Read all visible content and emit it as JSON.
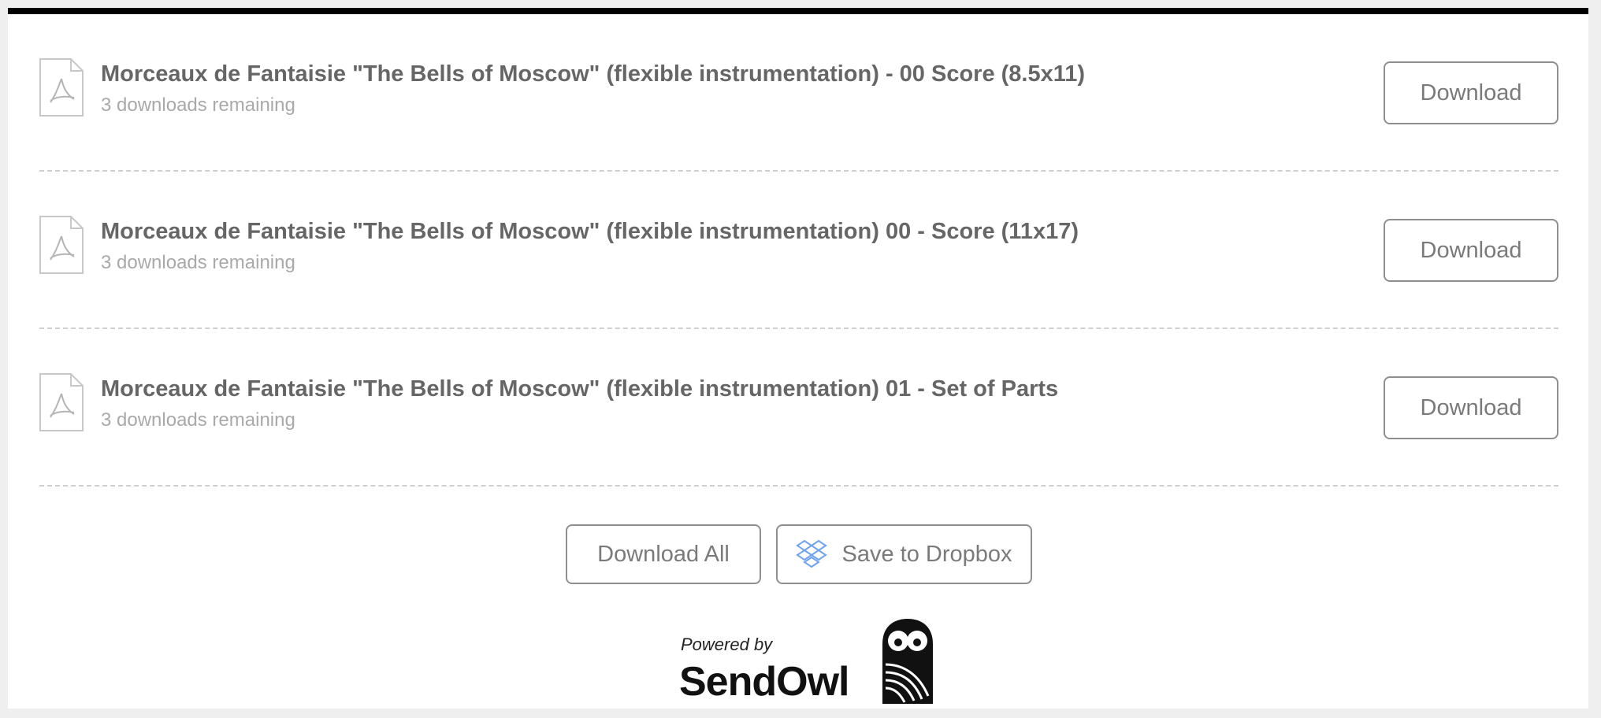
{
  "files": [
    {
      "title": "Morceaux de Fantaisie \"The Bells of Moscow\" (flexible instrumentation) - 00 Score (8.5x11)",
      "remaining": "3 downloads remaining",
      "button": "Download",
      "icon": "pdf-file-icon"
    },
    {
      "title": "Morceaux de Fantaisie \"The Bells of Moscow\" (flexible instrumentation) 00 - Score (11x17)",
      "remaining": "3 downloads remaining",
      "button": "Download",
      "icon": "pdf-file-icon"
    },
    {
      "title": "Morceaux de Fantaisie \"The Bells of Moscow\" (flexible instrumentation) 01 - Set of Parts",
      "remaining": "3 downloads remaining",
      "button": "Download",
      "icon": "pdf-file-icon"
    }
  ],
  "actions": {
    "download_all": "Download All",
    "save_dropbox": "Save to Dropbox",
    "dropbox_icon": "dropbox-icon"
  },
  "footer": {
    "powered_by": "Powered by",
    "brand": "SendOwl",
    "logo_icon": "owl-logo-icon"
  },
  "colors": {
    "top_bar": "#000000",
    "title_text": "#666666",
    "subtitle_text": "#a9a9a9",
    "button_border": "#8f8f8f",
    "dropbox_blue": "#6fa3f0"
  }
}
